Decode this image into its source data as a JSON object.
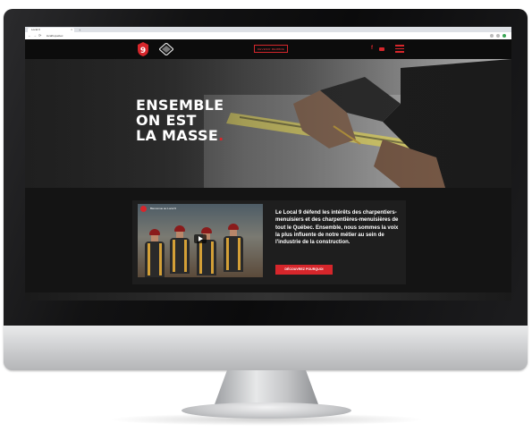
{
  "browser": {
    "tab_title": "Local 9",
    "tab_close": "×",
    "new_tab": "+",
    "back": "←",
    "forward": "→",
    "reload": "⟳",
    "url": "local9.quebec"
  },
  "header": {
    "logo_number": "9",
    "cta_label": "DEVENIR MEMBRE",
    "facebook": "f",
    "accent": "#d6262b"
  },
  "hero": {
    "line1": "ENSEMBLE",
    "line2": "ON EST",
    "line3": "LA MASSE",
    "period": "."
  },
  "video": {
    "title": "Bienvenue au Local 9"
  },
  "intro": {
    "text": "Le Local 9 défend les intérêts des charpentiers-menuisiers et des charpentières-menuisières de tout le Québec. Ensemble, nous sommes la voix la plus influente de notre métier au sein de l'industrie de la construction.",
    "button_label": "DÉCOUVREZ POURQUOI"
  }
}
